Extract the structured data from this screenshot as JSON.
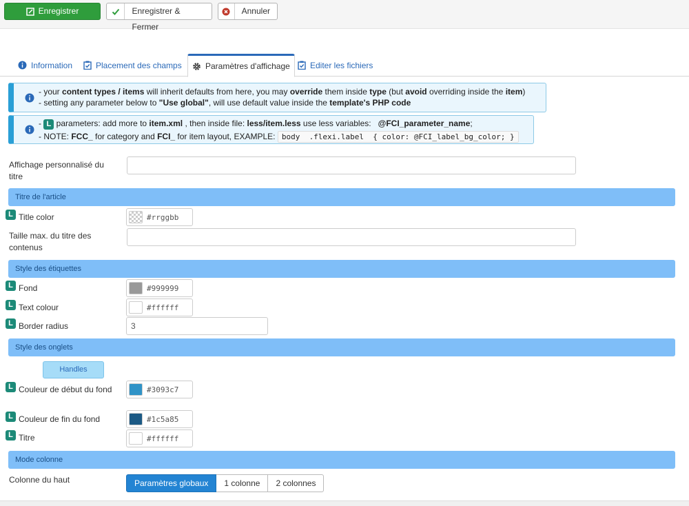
{
  "toolbar": {
    "save_label": "Enregistrer",
    "save_close_label": "Enregistrer & Fermer",
    "cancel_label": "Annuler"
  },
  "tabs": [
    {
      "label": "Information"
    },
    {
      "label": "Placement des champs"
    },
    {
      "label": "Paramètres d'affichage"
    },
    {
      "label": "Editer les fichiers"
    }
  ],
  "alert1": {
    "l1_a": "- your ",
    "l1_b": "content types / items",
    "l1_c": " will inherit defaults from here, you may ",
    "l1_d": "override",
    "l1_e": " them inside ",
    "l1_f": "type",
    "l1_g": " (but ",
    "l1_h": "avoid",
    "l1_i": " overriding inside the ",
    "l1_j": "item",
    "l1_k": ")",
    "l2_a": "- setting any parameter below to ",
    "l2_b": "\"Use global\"",
    "l2_c": ", will use default value inside the ",
    "l2_d": "template's PHP code"
  },
  "alert2": {
    "l1_a": "- ",
    "badge": "L",
    "l1_b": " parameters: add more to ",
    "l1_c": "item.xml",
    "l1_d": " , then inside file: ",
    "l1_e": "less/item.less",
    "l1_f": " use less variables:   ",
    "l1_g": "@FCI_parameter_name",
    "l1_h": ";",
    "l2_a": "- NOTE: ",
    "l2_b": "FCC_",
    "l2_c": " for category and ",
    "l2_d": "FCI_",
    "l2_e": " for item layout, EXAMPLE: ",
    "l2_code": "body  .flexi.label  { color: @FCI_label_bg_color; }"
  },
  "form": {
    "custom_title_label": "Affichage personnalisé du titre",
    "custom_title_value": "",
    "section_title": "Titre de l'article",
    "title_color_label": "Title color",
    "title_color_value": "#rrggbb",
    "title_maxlen_label": "Taille max. du titre des contenus",
    "title_maxlen_value": "",
    "section_labels": "Style des étiquettes",
    "bg_label": "Fond",
    "bg_value": "#999999",
    "text_colour_label": "Text colour",
    "text_colour_value": "#ffffff",
    "border_radius_label": "Border radius",
    "border_radius_value": "3",
    "section_tabs": "Style des onglets",
    "handles_label": "Handles",
    "start_color_label": "Couleur de début du fond",
    "start_color_value": "#3093c7",
    "end_color_label": "Couleur de fin du fond",
    "end_color_value": "#1c5a85",
    "titre_label": "Titre",
    "titre_value": "#ffffff",
    "section_column": "Mode colonne",
    "top_column_label": "Colonne du haut",
    "col_options": [
      "Paramètres globaux",
      "1 colonne",
      "2 colonnes"
    ]
  },
  "colors": {
    "accent": "#2a69b8",
    "save_green": "#2f9d3c",
    "section_bg": "#7fbef8",
    "badge_teal": "#1c8a78",
    "swatch_bg": "#999999",
    "swatch_text": "#ffffff",
    "swatch_start": "#3093c7",
    "swatch_end": "#1c5a85"
  }
}
